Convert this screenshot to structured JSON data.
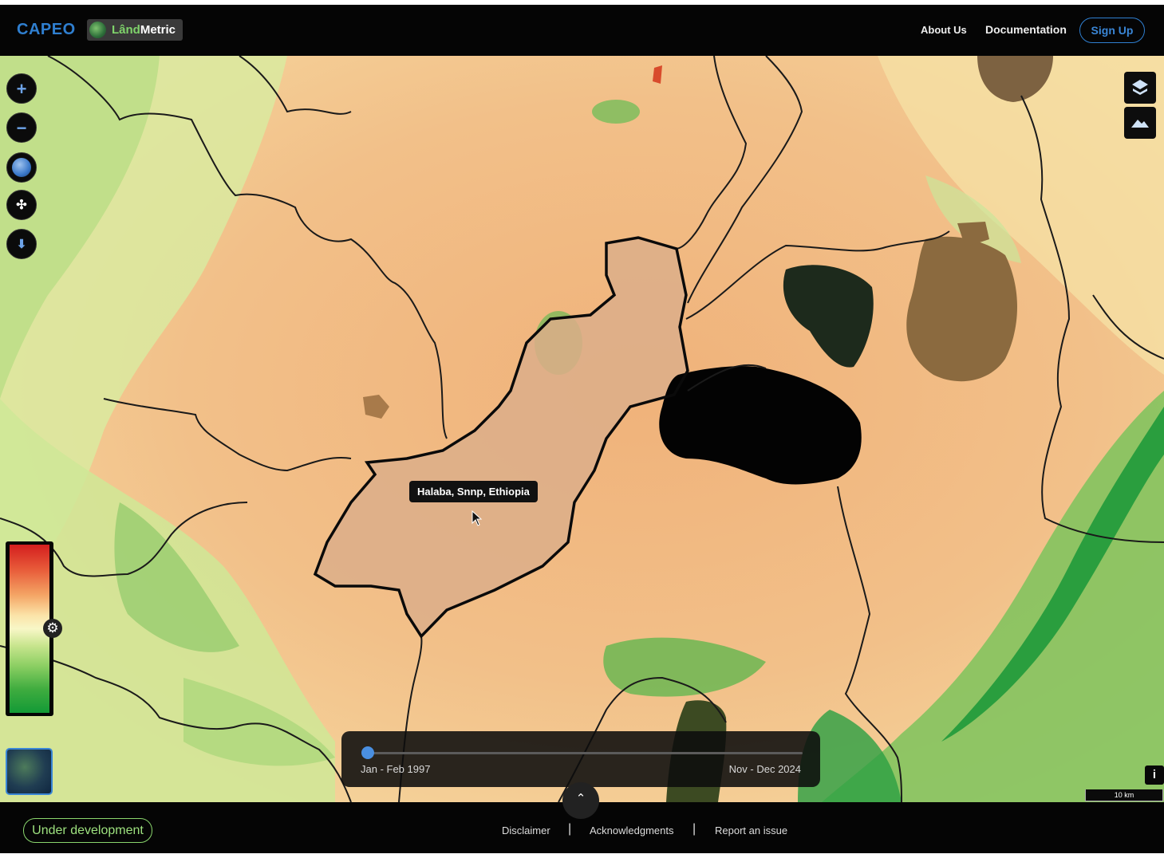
{
  "header": {
    "brand": "CAPEO",
    "logo_text_accent": "Lând",
    "logo_text_main": "Metric",
    "nav": [
      {
        "label": "About Us"
      },
      {
        "label": "Documentation"
      }
    ],
    "signup_label": "Sign Up"
  },
  "map": {
    "hover_tooltip": "Halaba, Snnp, Ethiopia",
    "left_controls": [
      {
        "icon": "plus-icon",
        "symbol": "+"
      },
      {
        "icon": "minus-icon",
        "symbol": "−"
      },
      {
        "icon": "globe-icon",
        "symbol": "◉"
      },
      {
        "icon": "move-icon",
        "symbol": "✣"
      },
      {
        "icon": "download-icon",
        "symbol": "⬇"
      }
    ],
    "right_controls": [
      {
        "icon": "layers-icon"
      },
      {
        "icon": "terrain-icon"
      }
    ],
    "legend": {
      "colors": [
        "#d41e1e",
        "#e85c3a",
        "#f4a565",
        "#fbe3a8",
        "#f8f7c7",
        "#c8e58e",
        "#8ccf63",
        "#3fac3f",
        "#139a36"
      ],
      "settings_icon": "gear-icon"
    },
    "basemap_thumbnail_icon": "satellite-thumbnail",
    "info_label": "i",
    "scale_label": "10 km"
  },
  "timeline": {
    "start_label": "Jan - Feb 1997",
    "end_label": "Nov - Dec 2024",
    "position": 0,
    "expand_icon": "chevron-up-icon"
  },
  "footer": {
    "status_badge": "Under development",
    "links": [
      {
        "label": "Disclaimer"
      },
      {
        "label": "Acknowledgments"
      },
      {
        "label": "Report an issue"
      }
    ],
    "separator": "|"
  }
}
